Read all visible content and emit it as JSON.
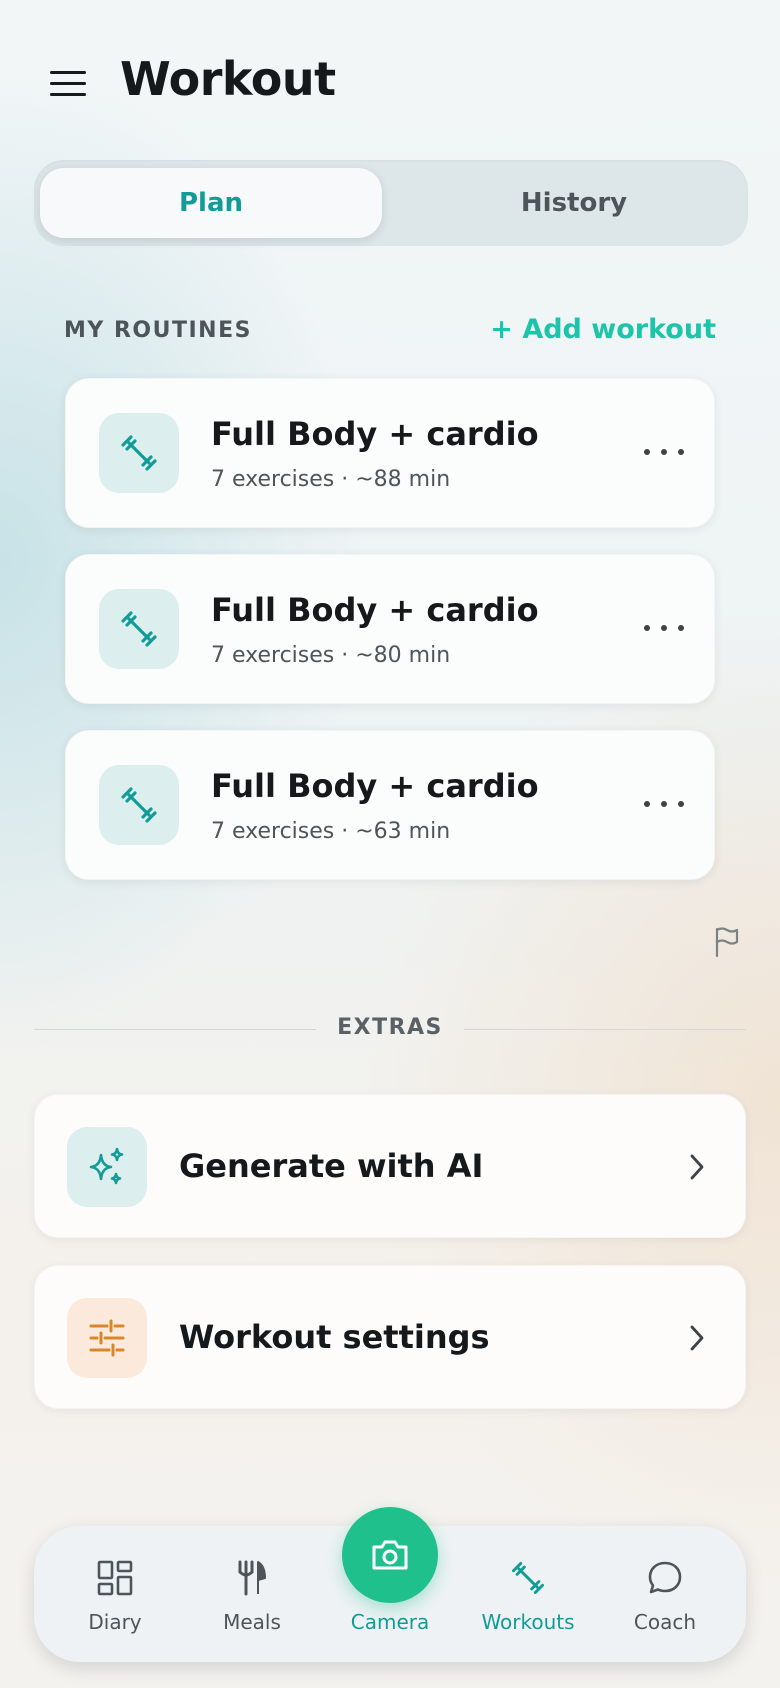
{
  "header": {
    "title": "Workout"
  },
  "tabs": {
    "plan": "Plan",
    "history": "History"
  },
  "routines": {
    "section_label": "MY ROUTINES",
    "add_label": "+ Add workout",
    "items": [
      {
        "name": "Full Body + cardio",
        "meta": "7 exercises · ~88 min"
      },
      {
        "name": "Full Body + cardio",
        "meta": "7 exercises · ~80 min"
      },
      {
        "name": "Full Body + cardio",
        "meta": "7 exercises · ~63 min"
      }
    ]
  },
  "extras": {
    "section_label": "EXTRAS",
    "items": [
      {
        "label": "Generate with AI",
        "icon": "sparkles-icon"
      },
      {
        "label": "Workout settings",
        "icon": "sliders-icon"
      }
    ]
  },
  "nav": {
    "diary": "Diary",
    "meals": "Meals",
    "camera": "Camera",
    "workouts": "Workouts",
    "coach": "Coach"
  },
  "colors": {
    "accent": "#119c97",
    "accent_bright": "#1cc4aa",
    "camera": "#20c08d",
    "settings_icon": "#d9862a"
  }
}
